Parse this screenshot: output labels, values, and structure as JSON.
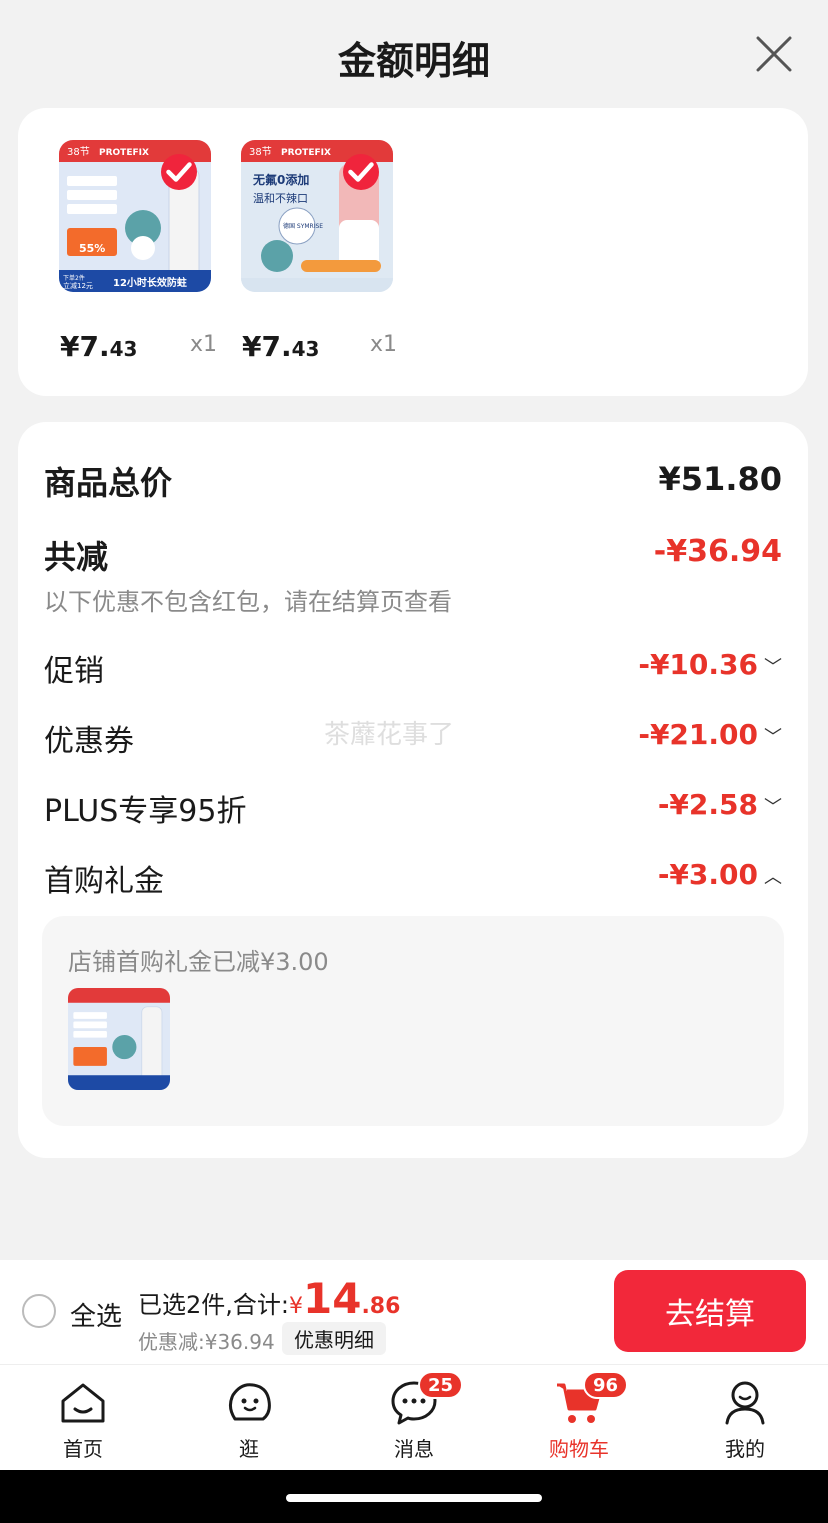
{
  "sheet": {
    "title": "金额明细"
  },
  "products": [
    {
      "price_int": "¥7.",
      "price_dec": "43",
      "qty": "x1",
      "image": {
        "banner": "38节",
        "brand": "PROTEFIX",
        "promo_top": "下单2件",
        "promo_save": "立减12元",
        "slogan": "12小时长效防蛀",
        "badge_pct": "55%"
      }
    },
    {
      "price_int": "¥7.",
      "price_dec": "43",
      "qty": "x1",
      "image": {
        "banner": "38节",
        "brand": "PROTEFIX",
        "headline1": "无氟0添加",
        "headline2": "温和不辣口",
        "seal": "德国 SYMRISE"
      }
    }
  ],
  "details": {
    "total_label": "商品总价",
    "total_value": "¥51.80",
    "reduce_label": "共减",
    "reduce_value": "-¥36.94",
    "reduce_note": "以下优惠不包含红包，请在结算页查看",
    "rows": [
      {
        "label": "促销",
        "value": "-¥10.36",
        "chevron": "chevron-down-icon"
      },
      {
        "label": "优惠券",
        "value": "-¥21.00",
        "chevron": "chevron-down-icon"
      },
      {
        "label": "PLUS专享95折",
        "value": "-¥2.58",
        "chevron": "chevron-down-icon"
      },
      {
        "label": "首购礼金",
        "value": "-¥3.00",
        "chevron": "chevron-up-icon"
      }
    ],
    "gift_text": "店铺首购礼金已减¥3.00",
    "watermark": "茶蘼花事了"
  },
  "checkout": {
    "select_all": "全选",
    "summary_prefix": "已选2件,合计:",
    "currency": "¥",
    "total_int": "14",
    "total_dec": ".86",
    "discount": "优惠减:¥36.94",
    "discount_detail": "优惠明细",
    "pay": "去结算"
  },
  "tabs": [
    {
      "label": "首页",
      "icon": "home-icon"
    },
    {
      "label": "逛",
      "icon": "browse-icon"
    },
    {
      "label": "消息",
      "icon": "message-icon",
      "badge": "25"
    },
    {
      "label": "购物车",
      "icon": "cart-icon",
      "badge": "96",
      "active": true
    },
    {
      "label": "我的",
      "icon": "profile-icon"
    }
  ],
  "colors": {
    "accent": "#e8332a",
    "button": "#f2283a"
  }
}
